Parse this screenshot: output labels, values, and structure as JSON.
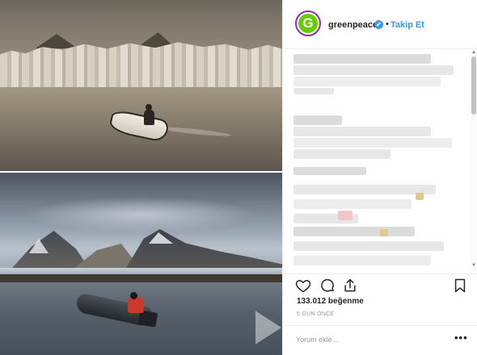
{
  "post": {
    "image": {
      "top_photo": "historic-glacier-rowboat",
      "bottom_photo": "modern-mountains-raft"
    }
  },
  "header": {
    "avatar_letter": "G",
    "username": "greenpeace",
    "verified_icon": "✔",
    "separator": "•",
    "follow_label": "Takip Et"
  },
  "comments_area": {
    "state": "pixelated"
  },
  "actions": {
    "like_icon": "heart-icon",
    "comment_icon": "comment-bubble-icon",
    "share_icon": "share-icon",
    "save_icon": "bookmark-icon"
  },
  "stats": {
    "likes": "133.012 beğenme",
    "time_ago": "5 GÜN ÖNCE"
  },
  "comment_box": {
    "placeholder": "Yorum ekle...",
    "more_label": "•••"
  },
  "colors": {
    "link_blue": "#3897f0",
    "greenpeace_green": "#66cc00",
    "story_ring": "#8c2fa8"
  }
}
